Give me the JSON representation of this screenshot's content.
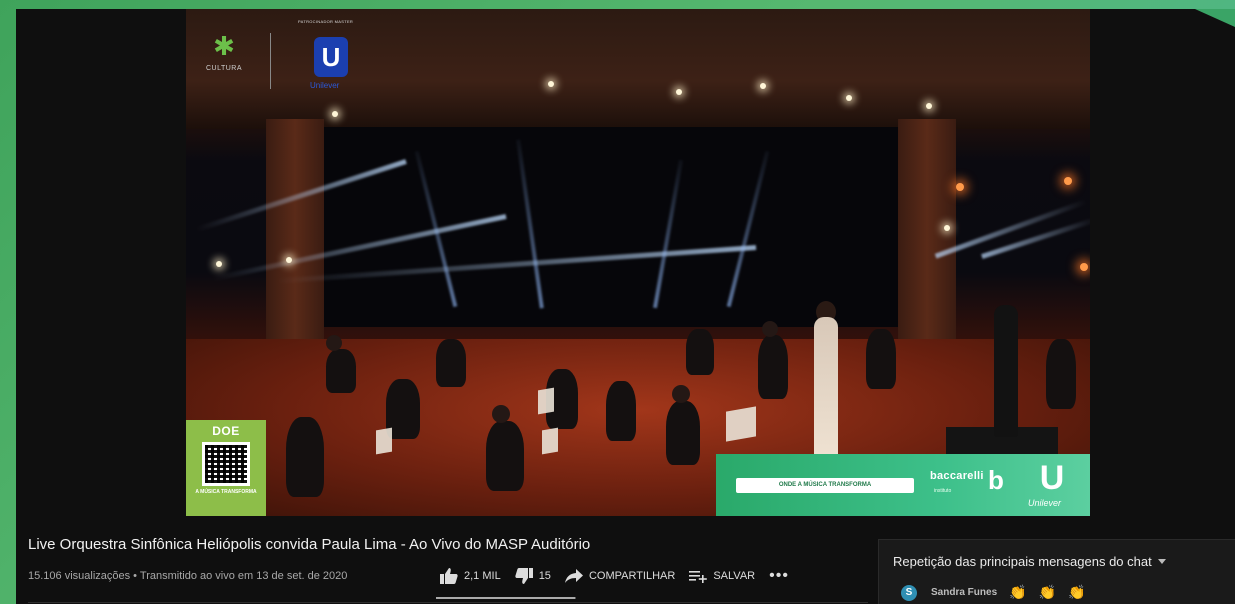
{
  "video": {
    "title": "Live Orquestra Sinfônica Heliópolis convida Paula Lima - Ao Vivo do MASP Auditório",
    "meta": "15.106 visualizações • Transmitido ao vivo em 13 de set. de 2020",
    "overlays": {
      "cultura_label": "CULTURA",
      "sponsor_label": "PATROCINADOR MASTER",
      "unilever_small_letter": "U",
      "unilever_small_name": "Unilever",
      "doe_title": "DOE",
      "doe_sub": "A MÚSICA TRANSFORMA",
      "banner_pill": "ONDE A MÚSICA TRANSFORMA",
      "baccarelli_name": "baccarelli",
      "baccarelli_sub": "instituto",
      "baccarelli_letter": "b",
      "unilever_big_letter": "U",
      "unilever_big_name": "Unilever"
    }
  },
  "actions": {
    "like": "2,1 MIL",
    "dislike": "15",
    "share": "COMPARTILHAR",
    "save": "SALVAR",
    "more": "•••",
    "like_ratio": 0.99
  },
  "chat": {
    "header": "Repetição das principais mensagens do chat",
    "message": {
      "avatar_letter": "S",
      "author": "Sandra Funes",
      "emojis": [
        "👏",
        "👏",
        "👏"
      ]
    }
  },
  "colors": {
    "background": "#0f0f0f",
    "banner": "#2aa96a",
    "doe": "#8dbe49",
    "avatar": "#2f8fb3"
  }
}
